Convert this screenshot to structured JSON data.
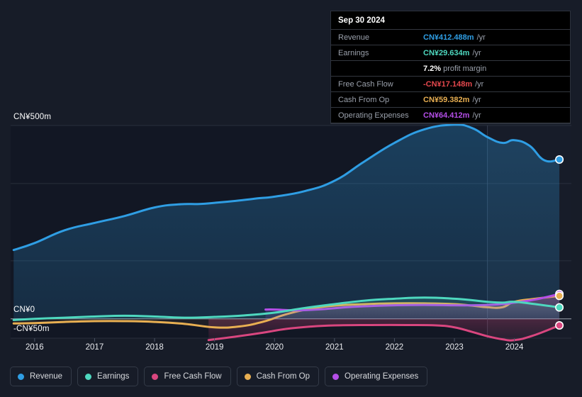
{
  "chart_data": {
    "type": "area",
    "title": "",
    "xlabel": "",
    "ylabel": "",
    "currency": "CN¥",
    "grid": true,
    "legend_position": "bottom",
    "ylim": [
      -50,
      500
    ],
    "y_ticks": [
      {
        "value": 500,
        "label": "CN¥500m"
      },
      {
        "value": 0,
        "label": "CN¥0"
      },
      {
        "value": -50,
        "label": "-CN¥50m"
      }
    ],
    "x_ticks": [
      "2016",
      "2017",
      "2018",
      "2019",
      "2020",
      "2021",
      "2022",
      "2023",
      "2024"
    ],
    "xlim": [
      2015.6,
      2024.95
    ],
    "forecast_divider_x": 2023.55,
    "series": [
      {
        "name": "Revenue",
        "color": "#2f9ee4",
        "x": [
          2015.65,
          2016.0,
          2016.5,
          2017.0,
          2017.5,
          2018.0,
          2018.4,
          2018.75,
          2019.0,
          2019.35,
          2019.75,
          2020.0,
          2020.5,
          2021.0,
          2021.5,
          2022.0,
          2022.5,
          2023.0,
          2023.3,
          2023.55,
          2023.8,
          2024.0,
          2024.25,
          2024.5,
          2024.75
        ],
        "values": [
          178,
          196,
          229,
          248,
          266,
          288,
          296,
          297,
          300,
          305,
          312,
          316,
          330,
          357,
          407,
          455,
          490,
          502,
          493,
          470,
          455,
          462,
          448,
          410,
          412
        ]
      },
      {
        "name": "Earnings",
        "color": "#4ed8bf",
        "x": [
          2015.65,
          2016.0,
          2016.5,
          2017.0,
          2017.5,
          2018.0,
          2018.5,
          2019.0,
          2019.5,
          2020.0,
          2020.5,
          2021.0,
          2021.5,
          2022.0,
          2022.5,
          2023.0,
          2023.3,
          2023.55,
          2023.8,
          2024.0,
          2024.35,
          2024.75
        ],
        "values": [
          -3,
          0,
          3,
          6,
          8,
          6,
          3,
          5,
          9,
          16,
          28,
          38,
          47,
          52,
          55,
          52,
          48,
          44,
          42,
          44,
          38,
          29.6
        ]
      },
      {
        "name": "Free Cash Flow",
        "color": "#d9467f",
        "x": [
          2018.9,
          2019.0,
          2019.4,
          2019.8,
          2020.2,
          2020.6,
          2021.0,
          2021.6,
          2022.2,
          2022.7,
          2023.0,
          2023.3,
          2023.55,
          2023.8,
          2024.0,
          2024.3,
          2024.75
        ],
        "values": [
          -55,
          -53,
          -45,
          -36,
          -26,
          -20,
          -17,
          -16,
          -16,
          -17,
          -22,
          -34,
          -45,
          -53,
          -55,
          -44,
          -17.1
        ]
      },
      {
        "name": "Cash From Op",
        "color": "#e8af52",
        "x": [
          2015.65,
          2016.0,
          2016.5,
          2017.0,
          2017.5,
          2018.0,
          2018.5,
          2019.0,
          2019.4,
          2019.8,
          2020.2,
          2020.6,
          2021.0,
          2021.5,
          2022.0,
          2022.5,
          2023.0,
          2023.3,
          2023.55,
          2023.8,
          2024.0,
          2024.35,
          2024.75
        ],
        "values": [
          -12,
          -11,
          -8,
          -6,
          -6,
          -8,
          -13,
          -22,
          -20,
          -8,
          12,
          26,
          34,
          38,
          40,
          40,
          38,
          34,
          30,
          30,
          44,
          52,
          59.4
        ]
      },
      {
        "name": "Operating Expenses",
        "color": "#b44ee8",
        "x": [
          2019.85,
          2020.0,
          2020.4,
          2020.8,
          2021.2,
          2021.6,
          2022.0,
          2022.5,
          2023.0,
          2023.3,
          2023.55,
          2023.8,
          2024.0,
          2024.35,
          2024.75
        ],
        "values": [
          24,
          24,
          22,
          25,
          30,
          33,
          35,
          36,
          35,
          35,
          36,
          38,
          42,
          50,
          64.4
        ]
      }
    ]
  },
  "tooltip": {
    "date": "Sep 30 2024",
    "rows": [
      {
        "key": "Revenue",
        "value": "CN¥412.488m",
        "unit": "/yr",
        "color": "#2f9ee4"
      },
      {
        "key": "Earnings",
        "value": "CN¥29.634m",
        "unit": "/yr",
        "color": "#4ed8bf"
      },
      {
        "key": "Free Cash Flow",
        "value": "-CN¥17.148m",
        "unit": "/yr",
        "color": "#e5484d"
      },
      {
        "key": "Cash From Op",
        "value": "CN¥59.382m",
        "unit": "/yr",
        "color": "#e8af52"
      },
      {
        "key": "Operating Expenses",
        "value": "CN¥64.412m",
        "unit": "/yr",
        "color": "#b44ee8"
      }
    ],
    "margin": {
      "value": "7.2%",
      "text": "profit margin"
    }
  },
  "legend": {
    "items": [
      {
        "label": "Revenue",
        "color": "#2f9ee4"
      },
      {
        "label": "Earnings",
        "color": "#4ed8bf"
      },
      {
        "label": "Free Cash Flow",
        "color": "#d9467f"
      },
      {
        "label": "Cash From Op",
        "color": "#e8af52"
      },
      {
        "label": "Operating Expenses",
        "color": "#b44ee8"
      }
    ]
  },
  "axis": {
    "y_top_label": "CN¥500m",
    "y_zero_label": "CN¥0",
    "y_bottom_label": "-CN¥50m"
  },
  "colors": {
    "background": "#171c28",
    "gridline": "#39414f",
    "zero_line": "#8c929c",
    "tooltip_bg": "#000000"
  }
}
